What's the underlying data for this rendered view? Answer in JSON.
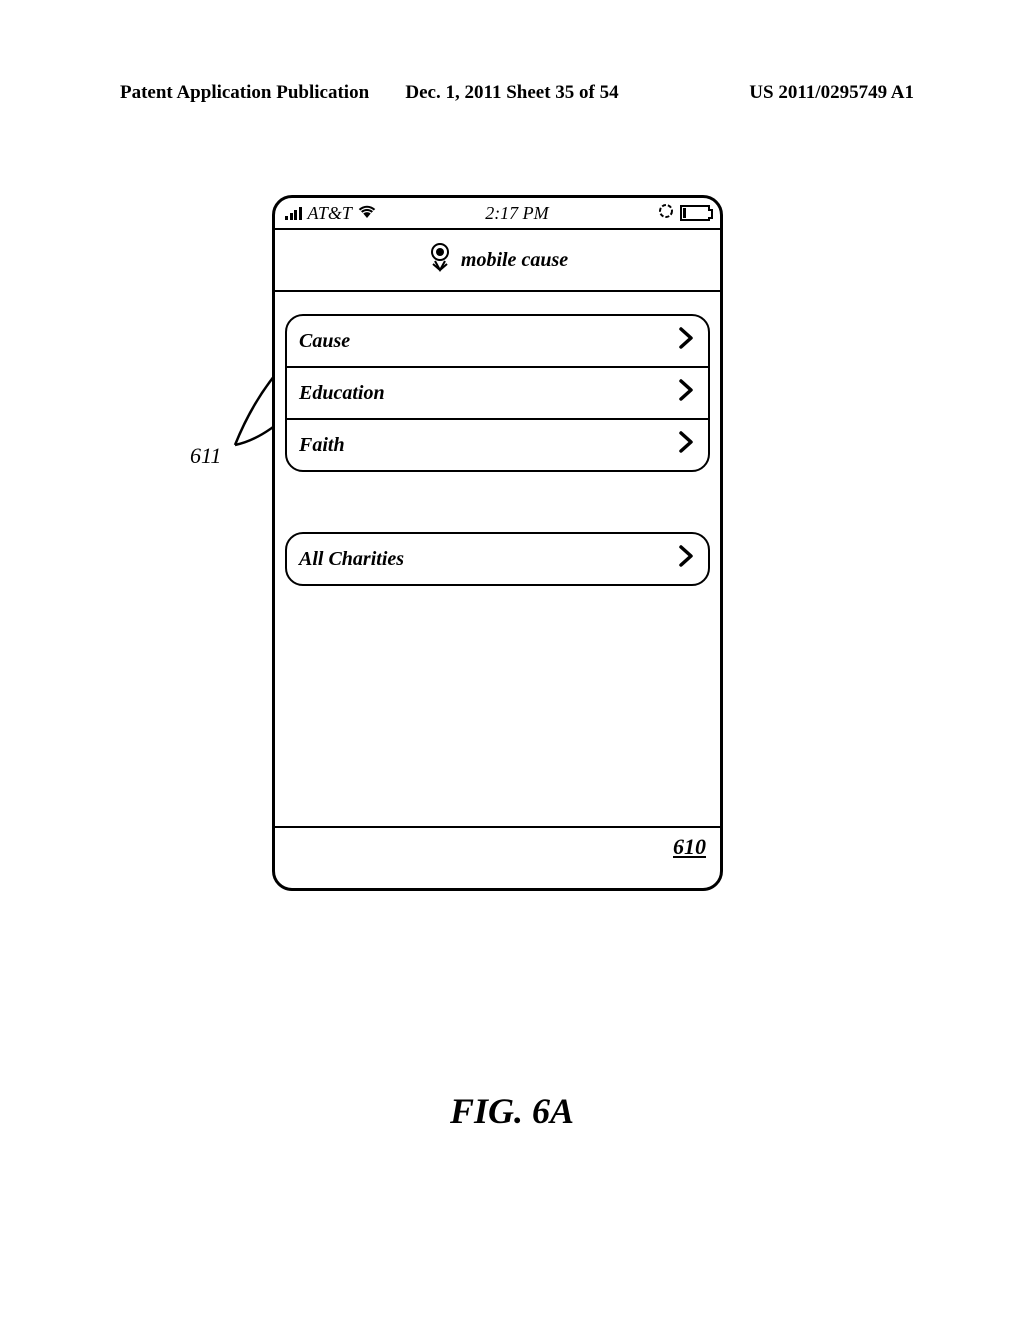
{
  "header": {
    "left": "Patent Application Publication",
    "center": "Dec. 1, 2011  Sheet 35 of 54",
    "right": "US 2011/0295749 A1"
  },
  "statusbar": {
    "carrier": "AT&T",
    "time": "2:17 PM"
  },
  "titlebar": {
    "app_name": "mobile cause"
  },
  "list": {
    "group1": [
      {
        "label": "Cause"
      },
      {
        "label": "Education"
      },
      {
        "label": "Faith"
      }
    ],
    "group2": [
      {
        "label": "All Charities"
      }
    ]
  },
  "callout": {
    "ref_611": "611",
    "ref_610": "610"
  },
  "figure": {
    "label": "FIG. 6A"
  }
}
